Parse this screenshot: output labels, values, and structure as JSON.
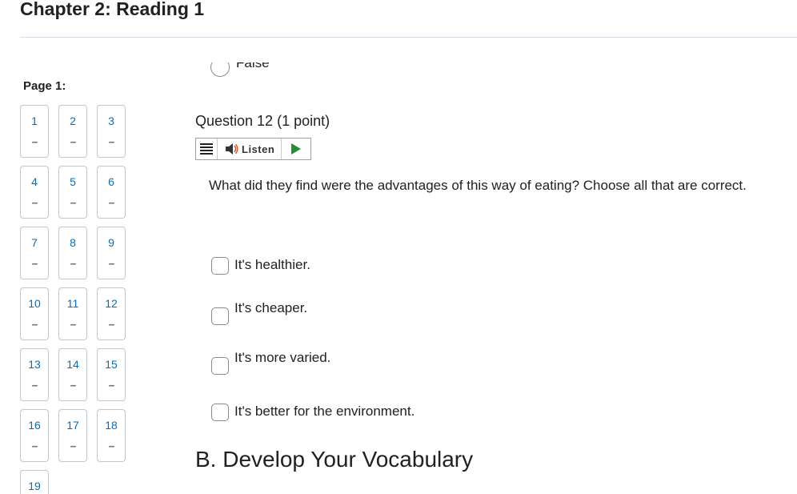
{
  "chapter": {
    "title": "Chapter 2: Reading 1"
  },
  "navigation": {
    "page_label": "Page 1:",
    "questions": [
      {
        "number": "1",
        "status": "--"
      },
      {
        "number": "2",
        "status": "--"
      },
      {
        "number": "3",
        "status": "--"
      },
      {
        "number": "4",
        "status": "--"
      },
      {
        "number": "5",
        "status": "--"
      },
      {
        "number": "6",
        "status": "--"
      },
      {
        "number": "7",
        "status": "--"
      },
      {
        "number": "8",
        "status": "--"
      },
      {
        "number": "9",
        "status": "--"
      },
      {
        "number": "10",
        "status": "--"
      },
      {
        "number": "11",
        "status": "--"
      },
      {
        "number": "12",
        "status": "--"
      },
      {
        "number": "13",
        "status": "--"
      },
      {
        "number": "14",
        "status": "--"
      },
      {
        "number": "15",
        "status": "--"
      },
      {
        "number": "16",
        "status": "--"
      },
      {
        "number": "17",
        "status": "--"
      },
      {
        "number": "18",
        "status": "--"
      },
      {
        "number": "19",
        "status": ""
      }
    ],
    "number_color": "#006fbf"
  },
  "previous_question": {
    "last_option": "False"
  },
  "question": {
    "label": "Question 12",
    "points": "(1 point)",
    "prompt": "What did they find were the advantages of this way of eating? Choose all that are correct.",
    "options": [
      {
        "text": "It's healthier.",
        "checked": false
      },
      {
        "text": "It's cheaper.",
        "checked": false
      },
      {
        "text": "It's more varied.",
        "checked": false
      },
      {
        "text": "It's better for the environment.",
        "checked": false
      }
    ]
  },
  "listen_toolbar": {
    "menu_icon": "hamburger-menu-icon",
    "speaker_icon": "speaker-icon",
    "listen_label": "Listen",
    "play_icon": "play-icon",
    "play_color": "#2a8a3a"
  },
  "next_section": {
    "heading": "B. Develop Your Vocabulary"
  }
}
